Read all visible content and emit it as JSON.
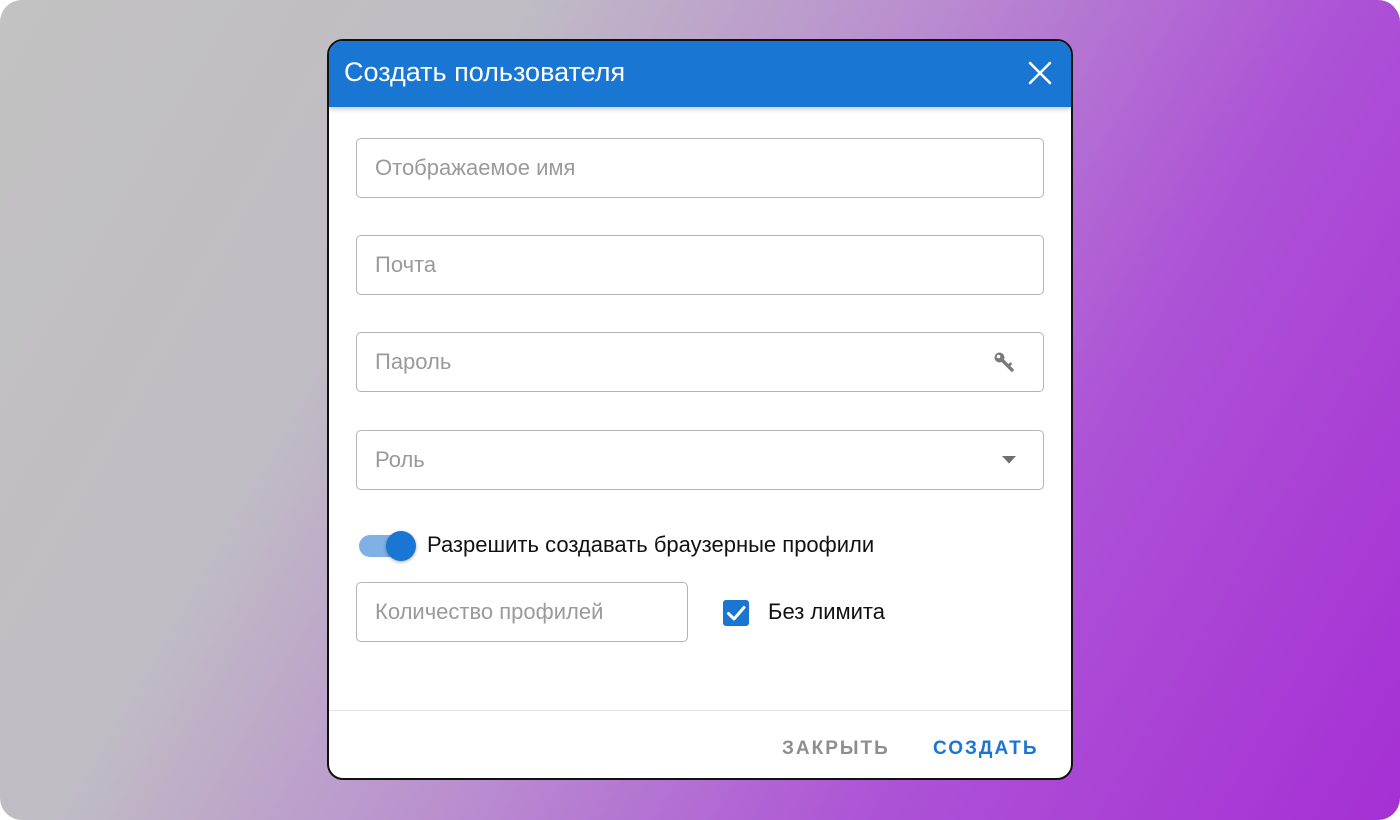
{
  "dialog": {
    "title": "Создать пользователя",
    "close_icon": "close-icon"
  },
  "form": {
    "display_name": {
      "placeholder": "Отображаемое имя",
      "value": ""
    },
    "email": {
      "placeholder": "Почта",
      "value": ""
    },
    "password": {
      "placeholder": "Пароль",
      "value": "",
      "icon": "key-icon"
    },
    "role": {
      "placeholder": "Роль",
      "icon": "dropdown-arrow-icon"
    },
    "allow_profiles": {
      "label": "Разрешить создавать браузерные профили",
      "checked": true
    },
    "profile_count": {
      "placeholder": "Количество профилей",
      "value": ""
    },
    "no_limit": {
      "label": "Без лимита",
      "checked": true
    }
  },
  "actions": {
    "close_label": "ЗАКРЫТЬ",
    "create_label": "СОЗДАТЬ"
  },
  "colors": {
    "primary": "#1976d2",
    "toggle_track": "#7fb0e6",
    "muted_button": "#8e8e8e",
    "field_border": "#b3b3b3"
  }
}
